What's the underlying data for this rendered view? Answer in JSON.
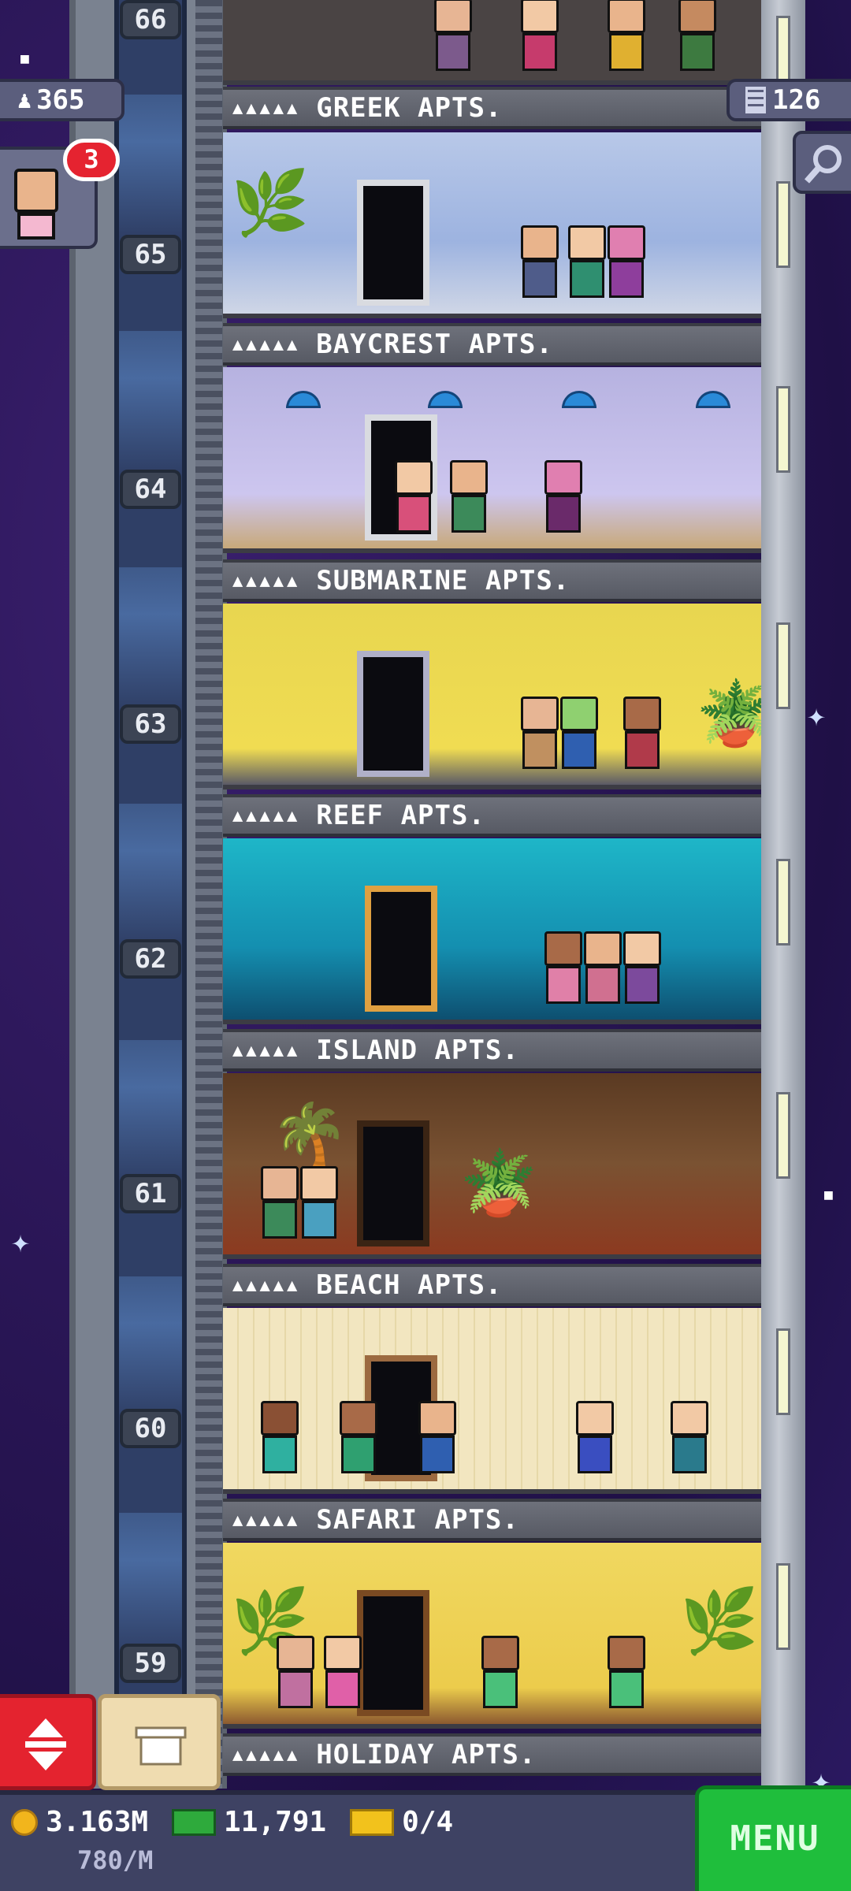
{
  "hud": {
    "population": "365",
    "floors": "126",
    "visitor_badge": "3"
  },
  "elevator_floor_numbers": [
    "66",
    "65",
    "64",
    "63",
    "62",
    "61",
    "60",
    "59"
  ],
  "floors": [
    {
      "name": "GREEK APTS.",
      "stars": "▲▲▲▲▲"
    },
    {
      "name": "BAYCREST APTS.",
      "stars": "▲▲▲▲▲"
    },
    {
      "name": "SUBMARINE APTS.",
      "stars": "▲▲▲▲▲"
    },
    {
      "name": "REEF APTS.",
      "stars": "▲▲▲▲▲"
    },
    {
      "name": "ISLAND APTS.",
      "stars": "▲▲▲▲▲"
    },
    {
      "name": "BEACH APTS.",
      "stars": "▲▲▲▲▲"
    },
    {
      "name": "SAFARI APTS.",
      "stars": "▲▲▲▲▲"
    },
    {
      "name": "HOLIDAY APTS.",
      "stars": "▲▲▲▲▲"
    }
  ],
  "bottom_bar": {
    "coins": "3.163M",
    "bux": "11,791",
    "tickets": "0/4",
    "income_rate": "780/M",
    "menu_label": "MENU"
  },
  "colors": {
    "menu_green": "#1fbe3c",
    "elevator_red": "#e4232f",
    "badge_red": "#e52330",
    "coin_gold": "#f2b51c",
    "bux_green": "#2eaa3c"
  }
}
